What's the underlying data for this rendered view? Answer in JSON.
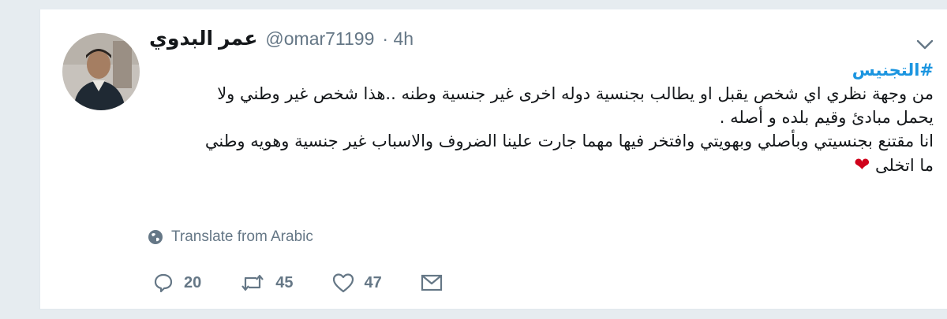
{
  "tweet": {
    "author": {
      "display_name": "عمر البدوي",
      "handle": "@omar71199",
      "time": "· 4h"
    },
    "hashtag": "#التجنيس",
    "lines": [
      "من وجهة نظري اي شخص يقبل او يطالب بجنسية دوله اخرى غير جنسية وطنه ..هذا شخص غير وطني ولا",
      "يحمل مبادئ وقيم بلده و أصله .",
      "انا مقتنع بجنسيتي وبأصلي وبهويتي وافتخر فيها مهما جارت علينا الضروف والاسباب   غير جنسية وهويه وطني",
      "ما اتخلى"
    ],
    "heart_emoji": "❤",
    "translate_label": "Translate from Arabic",
    "actions": {
      "reply_count": "20",
      "retweet_count": "45",
      "like_count": "47"
    }
  },
  "icons": {
    "more": "chevron-down-icon",
    "translate": "globe-icon",
    "reply": "reply-icon",
    "retweet": "retweet-icon",
    "like": "heart-icon",
    "dm": "envelope-icon"
  },
  "colors": {
    "background": "#e6ecf0",
    "hashtag": "#1b95e0",
    "secondary_text": "#657786",
    "heart": "#d0021b"
  }
}
